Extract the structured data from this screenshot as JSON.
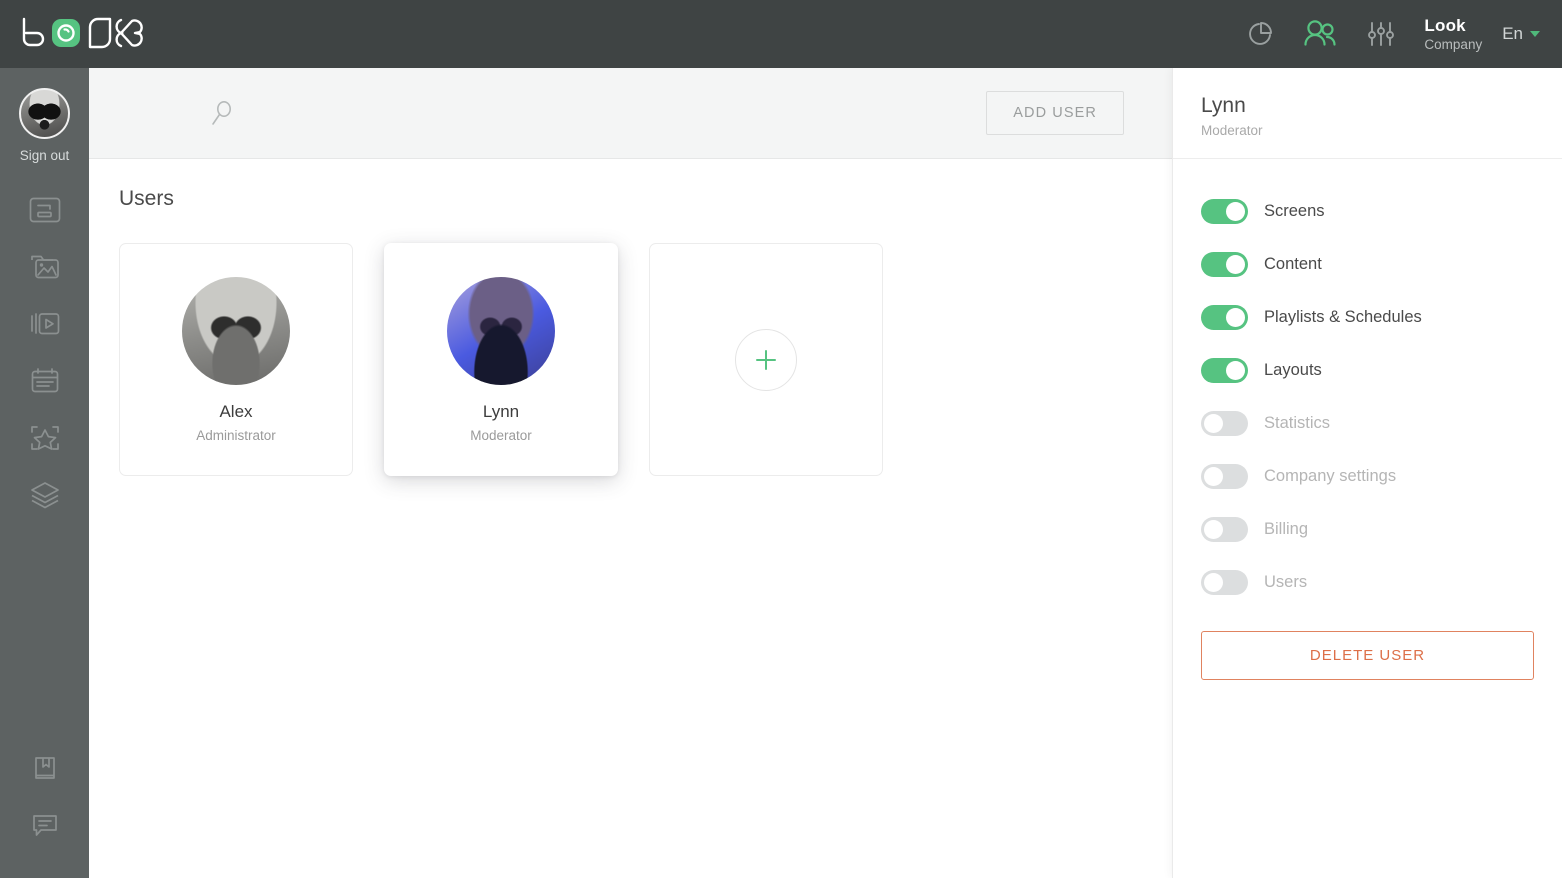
{
  "topbar": {
    "logo_text": "LOOK",
    "icons": [
      {
        "name": "analytics-icon",
        "label": "Statistics",
        "active": false
      },
      {
        "name": "users-icon",
        "label": "Users",
        "active": true
      },
      {
        "name": "settings-sliders-icon",
        "label": "Settings",
        "active": false
      }
    ],
    "brand_name": "Look",
    "brand_sub": "Company",
    "language": "En",
    "accent_green": "#56c381",
    "bar_bg": "#3f4444"
  },
  "sidebar": {
    "signout_label": "Sign out",
    "bg": "#5d6262",
    "nav_items": [
      {
        "label": "Screens",
        "icon": "screen-icon"
      },
      {
        "label": "Content",
        "icon": "images-icon"
      },
      {
        "label": "Playlists",
        "icon": "playlist-video-icon"
      },
      {
        "label": "Schedules",
        "icon": "schedule-calendar-icon"
      },
      {
        "label": "Apps",
        "icon": "star-frame-icon"
      },
      {
        "label": "Layouts",
        "icon": "layers-icon"
      }
    ],
    "bottom_items": [
      {
        "label": "Manual",
        "icon": "book-icon"
      },
      {
        "label": "Support",
        "icon": "chat-bubble-icon"
      }
    ]
  },
  "toolbar": {
    "search_placeholder": "Search",
    "add_user_label": "ADD USER"
  },
  "content": {
    "page_title": "Users",
    "cards": [
      {
        "name": "Alex",
        "role": "Administrator",
        "selected": false
      },
      {
        "name": "Lynn",
        "role": "Moderator",
        "selected": true
      }
    ],
    "add_card_label": "+"
  },
  "panel": {
    "user_name": "Lynn",
    "user_role": "Moderator",
    "permissions": [
      {
        "label": "Screens",
        "enabled": true
      },
      {
        "label": "Content",
        "enabled": true
      },
      {
        "label": "Playlists & Schedules",
        "enabled": true
      },
      {
        "label": "Layouts",
        "enabled": true
      },
      {
        "label": "Statistics",
        "enabled": false
      },
      {
        "label": "Company settings",
        "enabled": false
      },
      {
        "label": "Billing",
        "enabled": false
      },
      {
        "label": "Users",
        "enabled": false
      }
    ],
    "delete_label": "DELETE USER",
    "delete_color": "#dd6f48"
  }
}
